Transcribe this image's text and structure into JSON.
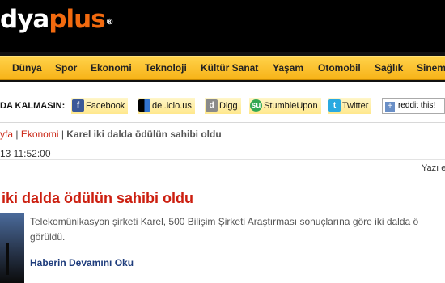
{
  "logo": {
    "part1": "dya",
    "part2": "plus",
    "mark": "®"
  },
  "nav": {
    "items": [
      "Dünya",
      "Spor",
      "Ekonomi",
      "Teknoloji",
      "Kültür Sanat",
      "Yaşam",
      "Otomobil",
      "Sağlık",
      "Sinem"
    ]
  },
  "share": {
    "lead": "DA KALMASIN:",
    "items": [
      {
        "label": "Facebook",
        "icon": "facebook-icon",
        "glyph": "f",
        "color": "#3b5998"
      },
      {
        "label": "del.icio.us",
        "icon": "delicious-icon",
        "glyph": "",
        "color": "#3274d0"
      },
      {
        "label": "Digg",
        "icon": "digg-icon",
        "glyph": "d",
        "color": "#888888"
      },
      {
        "label": "StumbleUpon",
        "icon": "stumbleupon-icon",
        "glyph": "su",
        "color": "#32a852"
      },
      {
        "label": "Twitter",
        "icon": "twitter-icon",
        "glyph": "t",
        "color": "#2aa9e0"
      }
    ],
    "reddit": {
      "label": "reddit this!",
      "glyph": "+",
      "icon": "reddit-plus-icon"
    }
  },
  "breadcrumb": {
    "home": "yfa",
    "section": "Ekonomi",
    "current": "Karel iki dalda ödülün sahibi oldu"
  },
  "article": {
    "datetime": "13 11:52:00",
    "author_prefix": "Yazı e",
    "headline": "iki dalda ödülün sahibi oldu",
    "summary": "Telekomünikasyon şirketi Karel, 500 Bilişim Şirketi Araştırması sonuçlarına göre iki dalda ö görüldü.",
    "more_link": "Haberin Devamını Oku"
  },
  "colors": {
    "accent": "#cc1f10",
    "nav_gold": "#f7b318",
    "logo_orange": "#f26a0f"
  }
}
